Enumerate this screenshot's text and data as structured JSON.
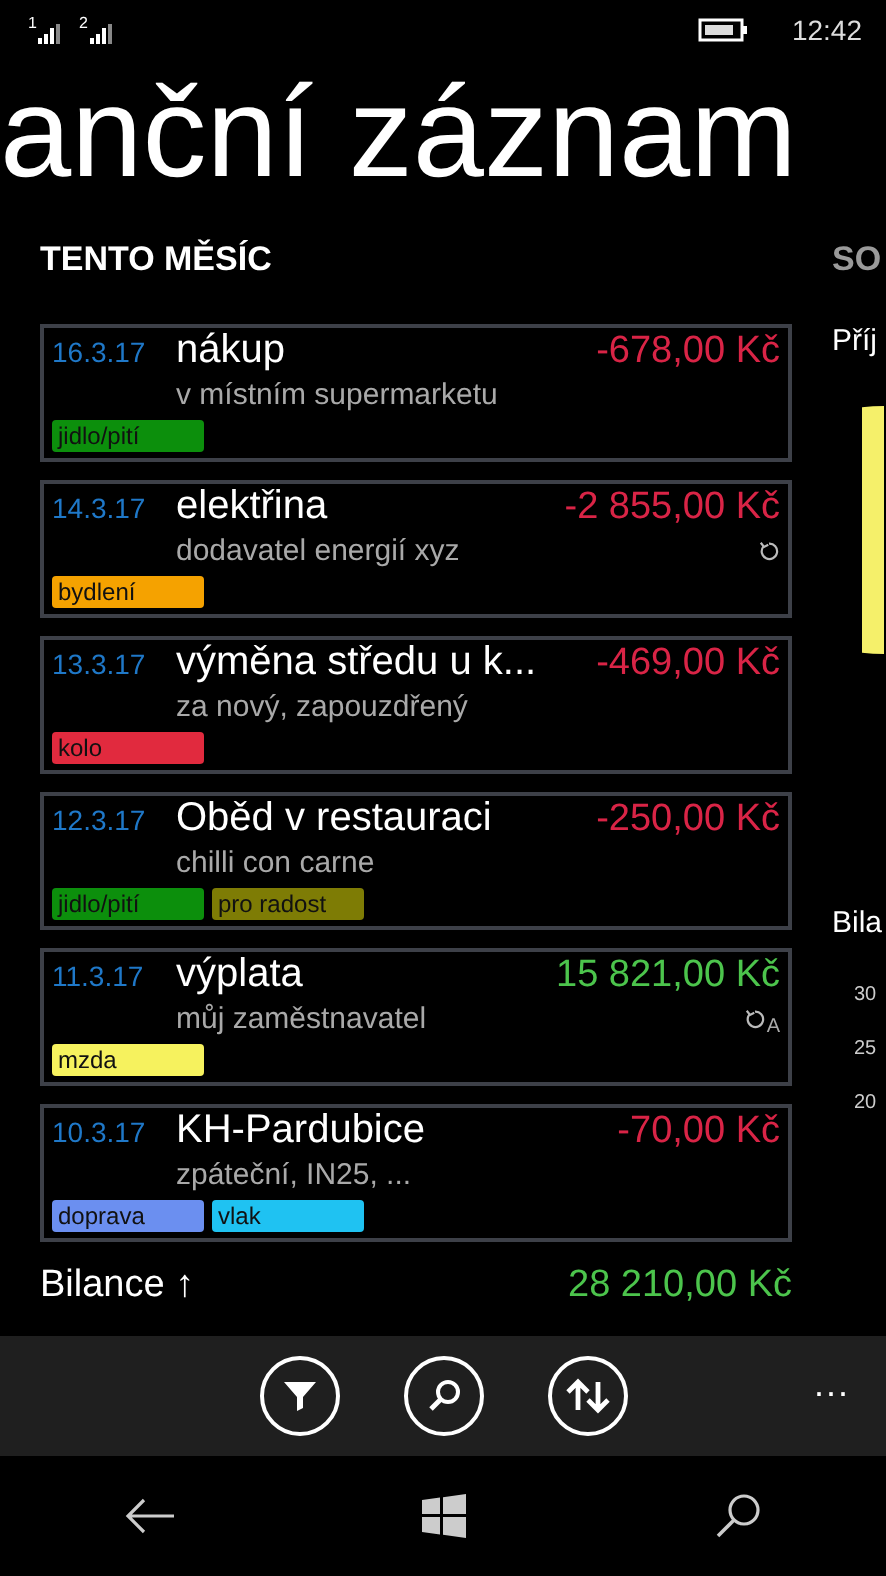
{
  "status_bar": {
    "sims": [
      "1",
      "2"
    ],
    "time": "12:42"
  },
  "title": "anční záznam",
  "pivots": [
    {
      "label": "TENTO MĚSÍC",
      "selected": true
    },
    {
      "label": "SO",
      "selected": false
    }
  ],
  "transactions": [
    {
      "date": "16.3.17",
      "title": "nákup",
      "note": "v místním supermarketu",
      "amount": "-678,00 Kč",
      "kind": "expense",
      "repeat": false,
      "tags": [
        {
          "label": "jidlo/pití",
          "color": "#0c8f0c"
        }
      ]
    },
    {
      "date": "14.3.17",
      "title": "elektřina",
      "note": "dodavatel energií xyz",
      "amount": "-2 855,00 Kč",
      "kind": "expense",
      "repeat": true,
      "tags": [
        {
          "label": "bydlení",
          "color": "#f5a200"
        }
      ]
    },
    {
      "date": "13.3.17",
      "title": "výměna středu u k...",
      "note": "za nový, zapouzdřený",
      "amount": "-469,00 Kč",
      "kind": "expense",
      "repeat": false,
      "tags": [
        {
          "label": "kolo",
          "color": "#e12a3e"
        }
      ]
    },
    {
      "date": "12.3.17",
      "title": "Oběd v restauraci",
      "note": "chilli con carne",
      "amount": "-250,00 Kč",
      "kind": "expense",
      "repeat": false,
      "tags": [
        {
          "label": "jidlo/pití",
          "color": "#0c8f0c"
        },
        {
          "label": "pro radost",
          "color": "#7e7c05"
        }
      ]
    },
    {
      "date": "11.3.17",
      "title": "výplata",
      "note": "můj zaměstnavatel",
      "amount": "15 821,00 Kč",
      "kind": "income",
      "repeat": true,
      "repeat_mark": "A",
      "tags": [
        {
          "label": "mzda",
          "color": "#f6f25e"
        }
      ]
    },
    {
      "date": "10.3.17",
      "title": "KH-Pardubice",
      "note": "zpáteční, IN25, ...",
      "amount": "-70,00 Kč",
      "kind": "expense",
      "repeat": false,
      "tags": [
        {
          "label": "doprava",
          "color": "#6b8ff0"
        },
        {
          "label": "vlak",
          "color": "#1fc2f2"
        }
      ]
    }
  ],
  "balance": {
    "label": "Bilance ↑",
    "amount": "28 210,00 Kč",
    "kind": "income"
  },
  "side": {
    "income_label": "Příj",
    "balance_label": "Bila",
    "axis": [
      "30",
      "25",
      "20"
    ]
  },
  "app_bar": {
    "more": "..."
  }
}
